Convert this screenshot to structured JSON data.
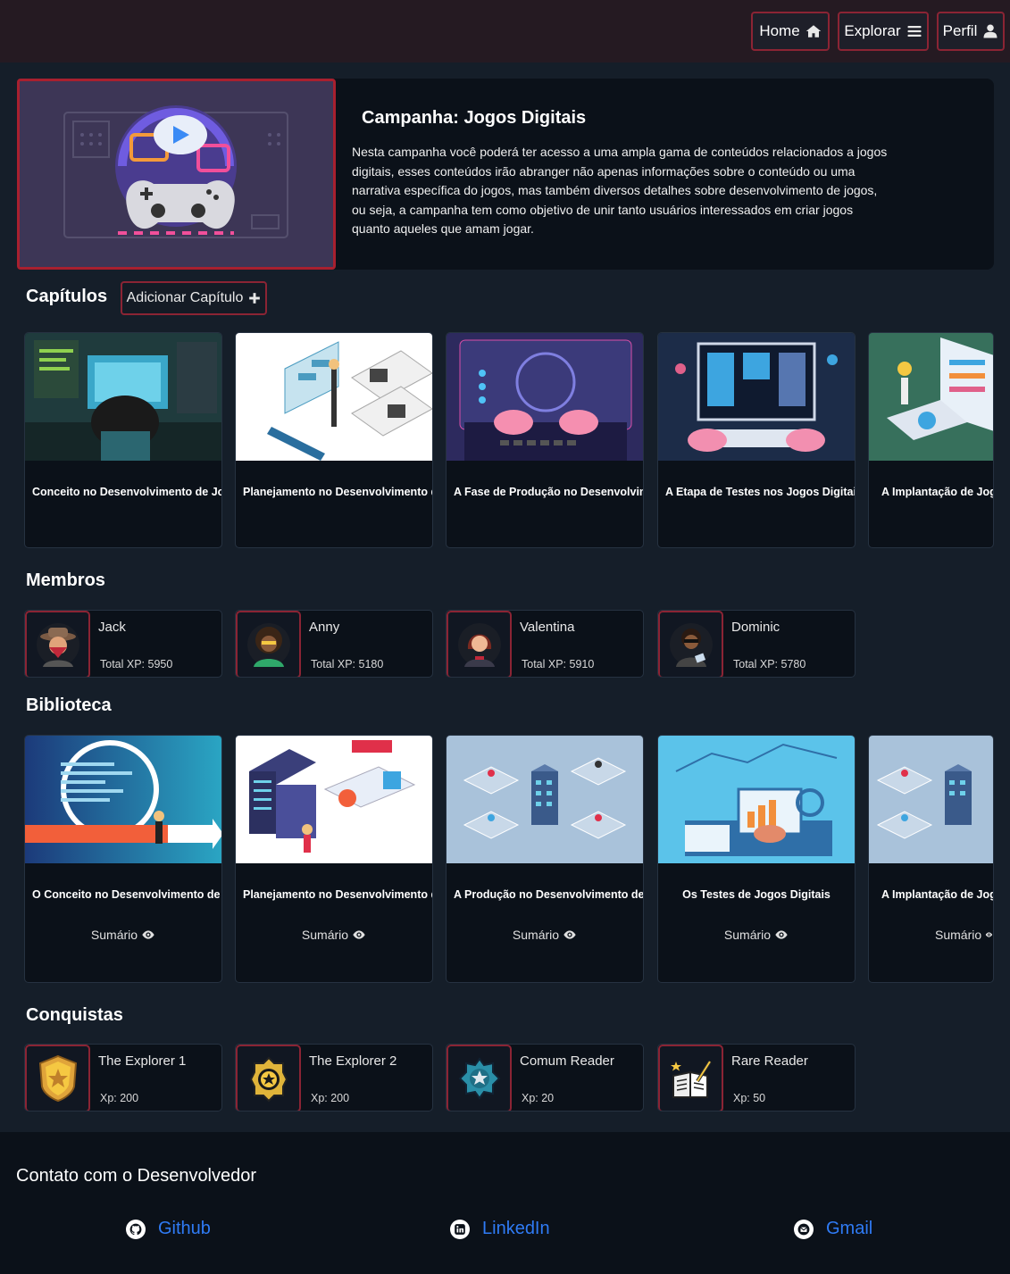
{
  "nav": {
    "home": "Home",
    "explore": "Explorar",
    "profile": "Perfil"
  },
  "hero": {
    "title": "Campanha: Jogos Digitais",
    "description": "Nesta campanha você poderá ter acesso a uma ampla gama de conteúdos relacionados a jogos digitais, esses conteúdos irão abranger não apenas informações sobre o conteúdo ou uma narrativa específica do jogos, mas também diversos detalhes sobre desenvolvimento de jogos, ou seja, a campanha tem como objetivo de unir tanto usuários interessados em criar jogos quanto aqueles que amam jogar."
  },
  "chapters": {
    "heading": "Capítulos",
    "add_label": "Adicionar Capítulo",
    "items": [
      {
        "title": "Conceito no Desenvolvimento de Jogos Digitais"
      },
      {
        "title": "Planejamento no Desenvolvimento de Jogos"
      },
      {
        "title": "A Fase de Produção no Desenvolvimento de Jogos"
      },
      {
        "title": "A Etapa de Testes nos Jogos Digitais"
      },
      {
        "title": "A Implantação de Jogos Digitais"
      }
    ]
  },
  "members": {
    "heading": "Membros",
    "items": [
      {
        "name": "Jack",
        "xp": "Total XP: 5950"
      },
      {
        "name": "Anny",
        "xp": "Total XP: 5180"
      },
      {
        "name": "Valentina",
        "xp": "Total XP: 5910"
      },
      {
        "name": "Dominic",
        "xp": "Total XP: 5780"
      }
    ]
  },
  "library": {
    "heading": "Biblioteca",
    "summary_label": "Sumário",
    "items": [
      {
        "title": "O Conceito no Desenvolvimento de Jogos Digitais"
      },
      {
        "title": "Planejamento no Desenvolvimento de Jogos"
      },
      {
        "title": "A Produção no Desenvolvimento de Jogos"
      },
      {
        "title": "Os Testes de Jogos Digitais"
      },
      {
        "title": "A Implantação de Jogos Digitais"
      }
    ]
  },
  "achievements": {
    "heading": "Conquistas",
    "items": [
      {
        "name": "The Explorer 1",
        "xp": "Xp: 200",
        "icon": "gold-badge-icon"
      },
      {
        "name": "The Explorer 2",
        "xp": "Xp: 200",
        "icon": "police-badge-icon"
      },
      {
        "name": "Comum Reader",
        "xp": "Xp: 20",
        "icon": "blue-star-badge-icon"
      },
      {
        "name": "Rare Reader",
        "xp": "Xp: 50",
        "icon": "book-pen-icon"
      }
    ]
  },
  "footer": {
    "title": "Contato com o Desenvolvedor",
    "github": "Github",
    "linkedin": "LinkedIn",
    "gmail": "Gmail"
  },
  "colors": {
    "accent_border": "#8b2434",
    "navbar_bg": "#251a22",
    "page_bg": "#151e29",
    "card_bg": "#0b1119",
    "link": "#2f7bf5"
  }
}
